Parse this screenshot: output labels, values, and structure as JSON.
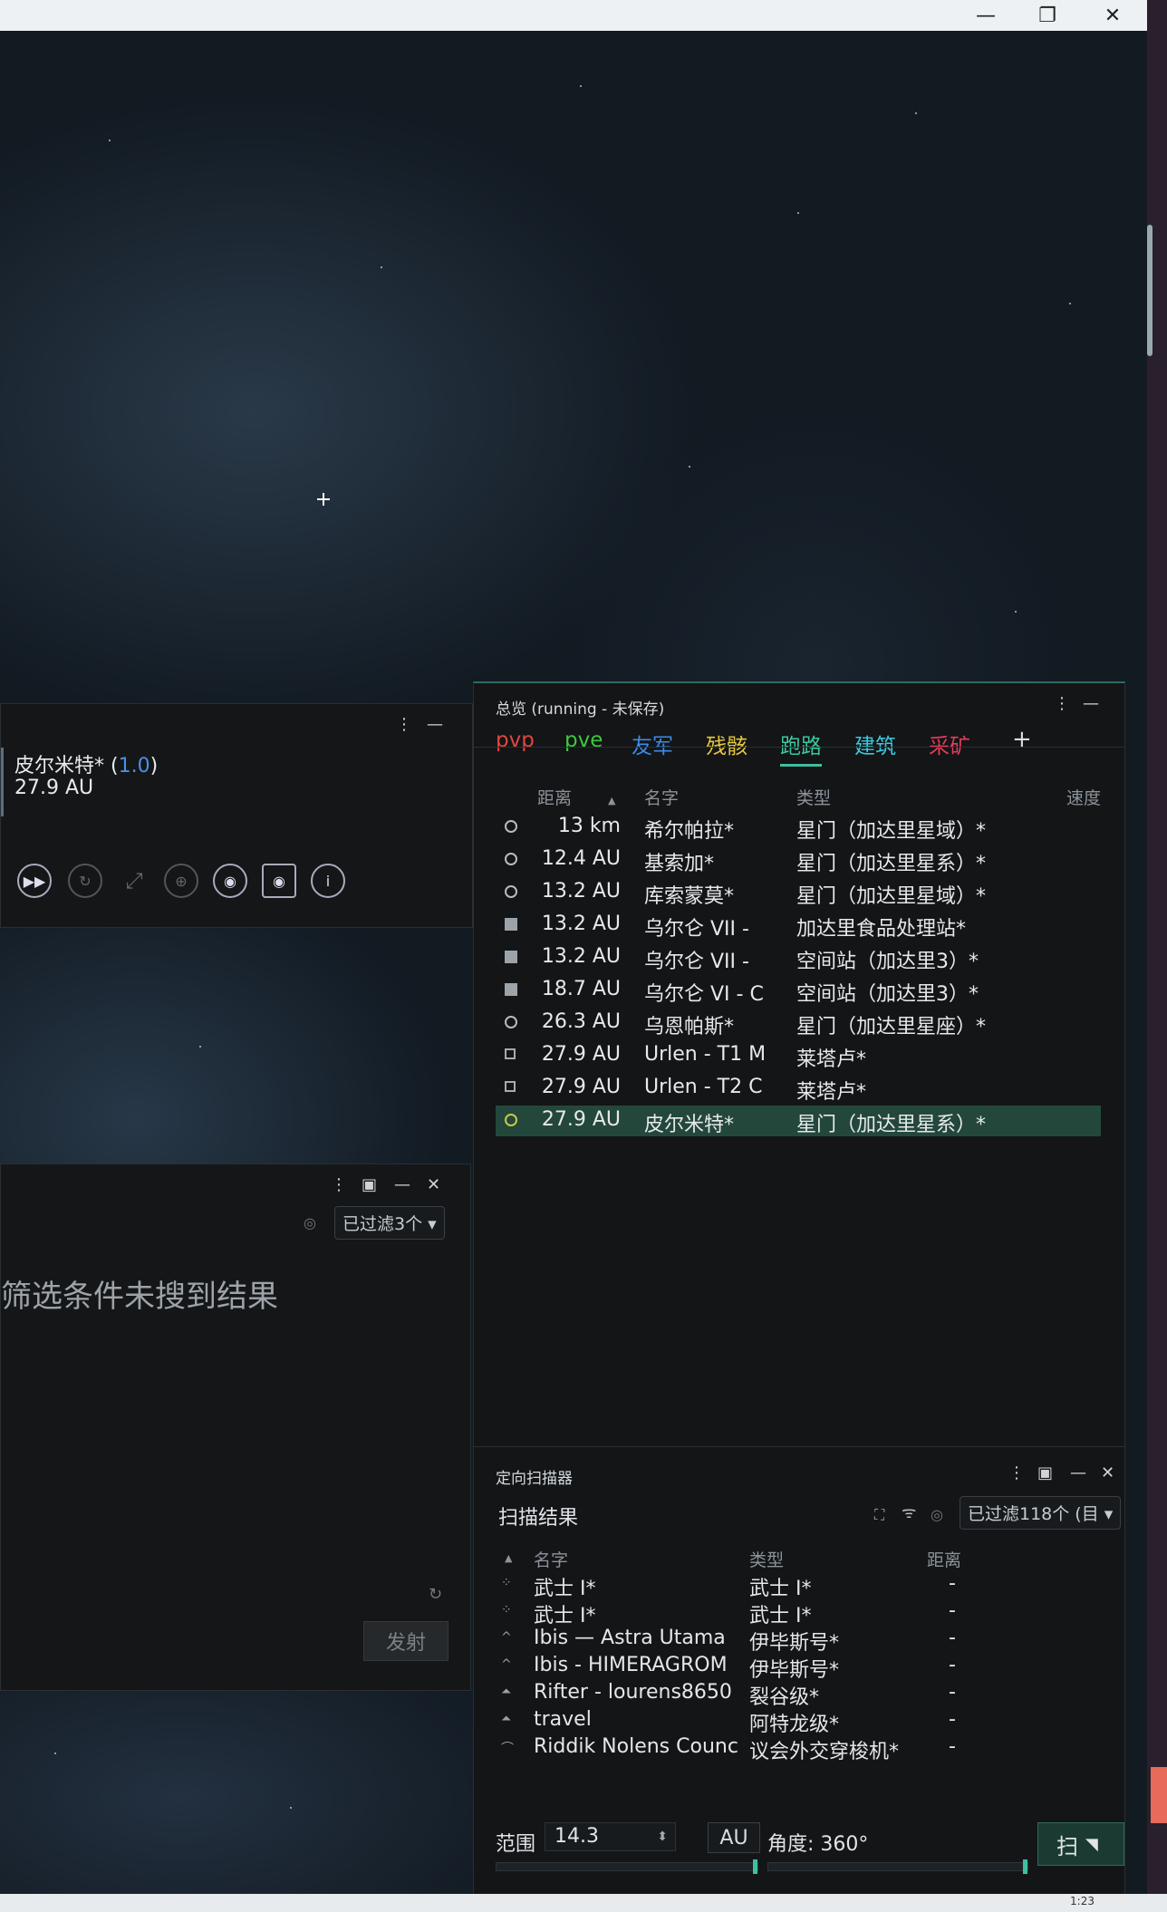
{
  "window": {
    "minimize": "—",
    "restore": "❐",
    "close": "✕"
  },
  "route": {
    "destination": "皮尔米特* (",
    "security": "1.0",
    "close_paren": ")",
    "distance": "27.9 AU",
    "menu": "⋮",
    "minimize": "—"
  },
  "search": {
    "menu": "⋮",
    "pin": "▣",
    "minimize": "—",
    "close": "✕",
    "filter": "已过滤3个",
    "no_result": "筛选条件未搜到结果",
    "fire_button": "发射"
  },
  "overview": {
    "title": "总览 (running - 未保存)",
    "menu": "⋮",
    "minimize": "—",
    "tabs": [
      {
        "label": "pvp",
        "color": "#e0463c"
      },
      {
        "label": "pve",
        "color": "#3cc83c"
      },
      {
        "label": "友军",
        "color": "#3c8ce6"
      },
      {
        "label": "残骸",
        "color": "#e6c83c"
      },
      {
        "label": "跑路",
        "color": "#3cc8a0"
      },
      {
        "label": "建筑",
        "color": "#3cc8dc"
      },
      {
        "label": "采矿",
        "color": "#e63c5a"
      }
    ],
    "add_tab": "+",
    "columns": {
      "distance": "距离",
      "name": "名字",
      "type": "类型",
      "speed": "速度"
    },
    "rows": [
      {
        "icon": "gate",
        "distance": "13 km",
        "name": "希尔帕拉*",
        "type": "星门（加达里星域）*"
      },
      {
        "icon": "gate",
        "distance": "12.4 AU",
        "name": "基索加*",
        "type": "星门（加达里星系）*"
      },
      {
        "icon": "gate",
        "distance": "13.2 AU",
        "name": "库索蒙莫*",
        "type": "星门（加达里星域）*"
      },
      {
        "icon": "station",
        "distance": "13.2 AU",
        "name": "乌尔仑 VII -",
        "type": "加达里食品处理站*"
      },
      {
        "icon": "station",
        "distance": "13.2 AU",
        "name": "乌尔仑 VII -",
        "type": "空间站（加达里3）*"
      },
      {
        "icon": "station",
        "distance": "18.7 AU",
        "name": "乌尔仑 VI - C",
        "type": "空间站（加达里3）*"
      },
      {
        "icon": "gate",
        "distance": "26.3 AU",
        "name": "乌恩帕斯*",
        "type": "星门（加达里星座）*"
      },
      {
        "icon": "tower",
        "distance": "27.9 AU",
        "name": "Urlen - T1 M",
        "type": "莱塔卢*"
      },
      {
        "icon": "tower",
        "distance": "27.9 AU",
        "name": "Urlen - T2 C",
        "type": "莱塔卢*"
      },
      {
        "icon": "gate-yellow",
        "distance": "27.9 AU",
        "name": "皮尔米特*",
        "type": "星门（加达里星系）*"
      }
    ]
  },
  "dscan": {
    "title": "定向扫描器",
    "menu": "⋮",
    "pin": "▣",
    "minimize": "—",
    "close": "✕",
    "subtitle": "扫描结果",
    "filter": "已过滤118个 (目",
    "columns": {
      "name": "名字",
      "type": "类型",
      "distance": "距离"
    },
    "rows": [
      {
        "name": "武士 I*",
        "type": "武士 I*",
        "distance": "-"
      },
      {
        "name": "武士 I*",
        "type": "武士 I*",
        "distance": "-"
      },
      {
        "name": "Ibis — Astra Utama",
        "type": "伊毕斯号*",
        "distance": "-"
      },
      {
        "name": "Ibis - HIMERAGROM",
        "type": "伊毕斯号*",
        "distance": "-"
      },
      {
        "name": "Rifter - lourens8650",
        "type": "裂谷级*",
        "distance": "-"
      },
      {
        "name": "travel",
        "type": "阿特龙级*",
        "distance": "-"
      },
      {
        "name": "Riddik Nolens Counc",
        "type": "议会外交穿梭机*",
        "distance": "-"
      }
    ],
    "range_label": "范围",
    "range_value": "14.3",
    "unit": "AU",
    "angle": "角度: 360°",
    "scan_button": "扫"
  },
  "taskbar": {
    "clock": "1:23"
  }
}
